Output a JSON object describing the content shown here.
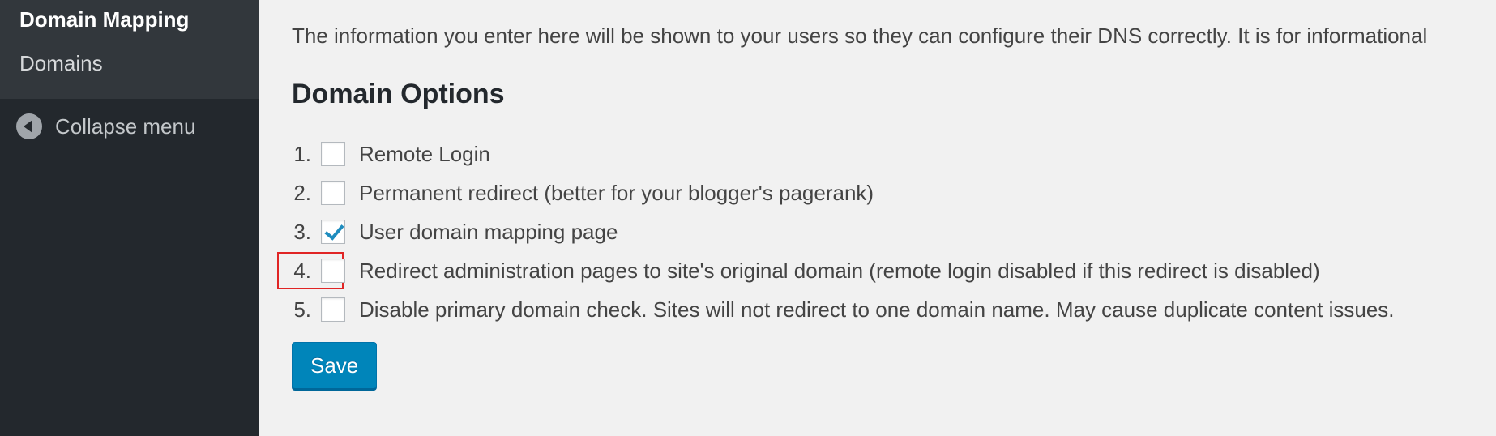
{
  "sidebar": {
    "submenu_title": "Domain Mapping",
    "submenu_items": [
      "Domains"
    ],
    "collapse_label": "Collapse menu"
  },
  "main": {
    "info_text": "The information you enter here will be shown to your users so they can configure their DNS correctly. It is for informational",
    "heading": "Domain Options",
    "options": [
      {
        "number": "1.",
        "label": "Remote Login",
        "checked": false
      },
      {
        "number": "2.",
        "label": "Permanent redirect (better for your blogger's pagerank)",
        "checked": false
      },
      {
        "number": "3.",
        "label": "User domain mapping page",
        "checked": true
      },
      {
        "number": "4.",
        "label": "Redirect administration pages to site's original domain (remote login disabled if this redirect is disabled)",
        "checked": false,
        "highlighted": true
      },
      {
        "number": "5.",
        "label": "Disable primary domain check. Sites will not redirect to one domain name. May cause duplicate content issues.",
        "checked": false
      }
    ],
    "save_label": "Save"
  },
  "colors": {
    "sidebar_bg": "#23282d",
    "submenu_bg": "#32373c",
    "content_bg": "#f1f1f1",
    "primary_button": "#0085ba",
    "checkmark": "#1e8cbe",
    "highlight_border": "#e02525"
  },
  "icons": {
    "collapse": "arrow-left-circle-icon",
    "checked": "checkmark-icon"
  }
}
